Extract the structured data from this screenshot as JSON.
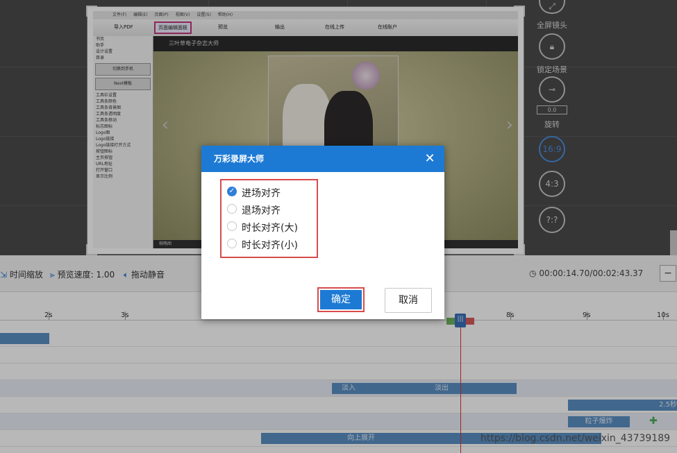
{
  "stage": {
    "inner_menubar": [
      "文件(F)",
      "编辑(E)",
      "页面(P)",
      "视图(V)",
      "设置(S)",
      "帮助(H)"
    ],
    "inner_toolbar": {
      "import_pdf": "导入PDF",
      "page_edit_panel": "页面编辑面板",
      "preview": "预览",
      "output": "输出",
      "online_upload": "在线上传",
      "online_account": "在线账户"
    },
    "inner_left": {
      "tabs": [
        "书页",
        "助手",
        "设计设置",
        "目录"
      ],
      "buttons": [
        "切换到手机",
        "Next模板"
      ],
      "tree": [
        "工具栏设置",
        "工具条颜色",
        "工具条背景图",
        "工具条透明度",
        "工具条移动",
        "标志图标",
        "Logo图",
        "Logo链接",
        "Logo链接打开方式",
        "按钮图标",
        "主页按钮",
        "URL地址",
        "打开窗口",
        "显示比例"
      ]
    },
    "inner_title": "三叶草电子杂志大师",
    "inner_status": "缩略图"
  },
  "side_controls": {
    "fullscreen_label": "全屏镜头",
    "lock_label": "锁定场景",
    "rotate_value": "0.0",
    "rotate_label": "旋转",
    "ratio_16_9": "16:9",
    "ratio_4_3": "4:3",
    "ratio_custom": "?:?"
  },
  "ctrlbar": {
    "time_zoom": "时间缩放",
    "preview_speed": "预览速度: 1.00",
    "drag_mute": "拖动静音",
    "time_display": "00:00:14.70/00:02:43.37"
  },
  "ruler": {
    "labels": [
      "2s",
      "3s",
      "8s",
      "9s",
      "10s"
    ]
  },
  "tracks": {
    "fade_in": "淡入",
    "fade_out": "淡出",
    "duration": "2.5秒",
    "particle": "粒子爆炸",
    "unfold_up": "向上展开"
  },
  "playhead_symbol": "|||",
  "watermark": "https://blog.csdn.net/weixin_43739189",
  "dialog": {
    "title": "万彩录屏大师",
    "close_symbol": "✕",
    "options": [
      {
        "label": "进场对齐",
        "checked": true
      },
      {
        "label": "退场对齐",
        "checked": false
      },
      {
        "label": "时长对齐(大)",
        "checked": false
      },
      {
        "label": "时长对齐(小)",
        "checked": false
      }
    ],
    "confirm_label": "确定",
    "cancel_label": "取消"
  },
  "colors": {
    "accent": "#1d7ad4",
    "highlight": "#d84b4b"
  }
}
